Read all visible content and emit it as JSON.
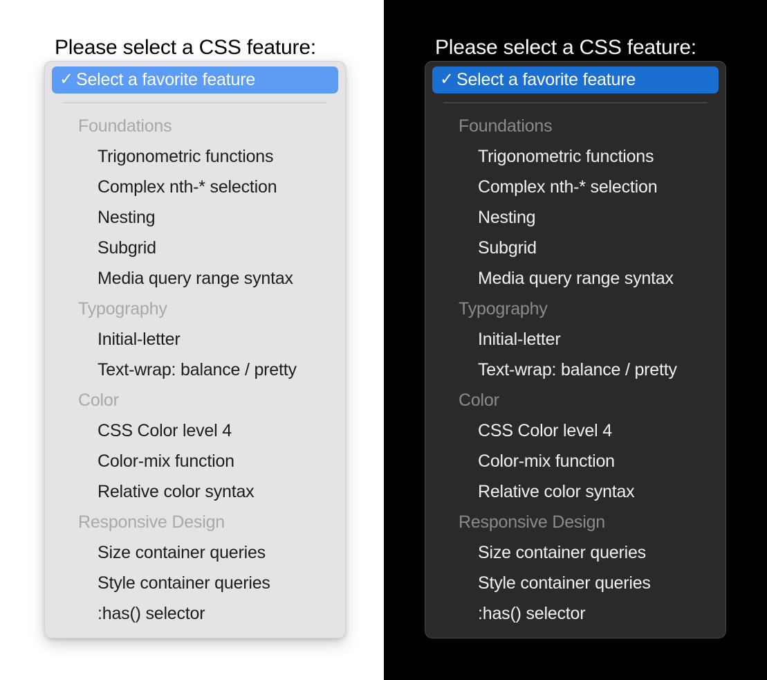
{
  "prompt": "Please select a CSS feature:",
  "dropdown": {
    "selected_option": "Select a favorite feature",
    "check_icon": "✓",
    "groups": [
      {
        "label": "Foundations",
        "options": [
          "Trigonometric functions",
          "Complex nth-* selection",
          "Nesting",
          "Subgrid",
          "Media query range syntax"
        ]
      },
      {
        "label": "Typography",
        "options": [
          "Initial-letter",
          "Text-wrap: balance / pretty"
        ]
      },
      {
        "label": "Color",
        "options": [
          "CSS Color level 4",
          "Color-mix function",
          "Relative color syntax"
        ]
      },
      {
        "label": "Responsive Design",
        "options": [
          "Size container queries",
          "Style container queries",
          ":has() selector"
        ]
      }
    ]
  },
  "themes": [
    {
      "name": "light",
      "page_background": "#ffffff",
      "panel_background": "#e4e4e6",
      "highlight_color": "#5d9cf5",
      "text_color": "#1c1c1e",
      "group_label_color": "#a8a8aa",
      "separator_color": "#c6c6c8"
    },
    {
      "name": "dark",
      "page_background": "#000000",
      "panel_background": "#2b2a29",
      "highlight_color": "#1a6fd0",
      "text_color": "#f2f1f0",
      "group_label_color": "#8d8b89",
      "separator_color": "#5d5b59"
    }
  ]
}
